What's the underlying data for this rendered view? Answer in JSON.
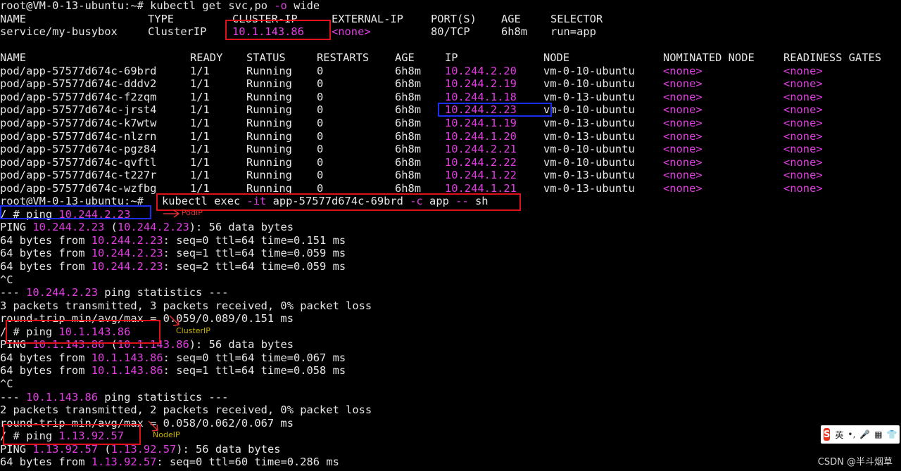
{
  "terminal": {
    "prompt_cmd_1": "root@VM-0-13-ubuntu:~# kubectl get svc,po -o wide",
    "svc_headers": [
      "NAME",
      "TYPE",
      "CLUSTER-IP",
      "EXTERNAL-IP",
      "PORT(S)",
      "AGE",
      "SELECTOR"
    ],
    "svc_row": [
      "service/my-busybox",
      "ClusterIP",
      "10.1.143.86",
      "<none>",
      "80/TCP",
      "6h8m",
      "run=app"
    ],
    "pod_headers": [
      "NAME",
      "READY",
      "STATUS",
      "RESTARTS",
      "AGE",
      "IP",
      "NODE",
      "NOMINATED NODE",
      "READINESS GATES"
    ],
    "pods": [
      [
        "pod/app-57577d674c-69brd",
        "1/1",
        "Running",
        "0",
        "6h8m",
        "10.244.2.20",
        "vm-0-10-ubuntu",
        "<none>",
        "<none>"
      ],
      [
        "pod/app-57577d674c-dddv2",
        "1/1",
        "Running",
        "0",
        "6h8m",
        "10.244.2.19",
        "vm-0-10-ubuntu",
        "<none>",
        "<none>"
      ],
      [
        "pod/app-57577d674c-f2zqm",
        "1/1",
        "Running",
        "0",
        "6h8m",
        "10.244.1.18",
        "vm-0-13-ubuntu",
        "<none>",
        "<none>"
      ],
      [
        "pod/app-57577d674c-jrst4",
        "1/1",
        "Running",
        "0",
        "6h8m",
        "10.244.2.23",
        "vm-0-10-ubuntu",
        "<none>",
        "<none>"
      ],
      [
        "pod/app-57577d674c-k7wtw",
        "1/1",
        "Running",
        "0",
        "6h8m",
        "10.244.1.19",
        "vm-0-13-ubuntu",
        "<none>",
        "<none>"
      ],
      [
        "pod/app-57577d674c-nlzrn",
        "1/1",
        "Running",
        "0",
        "6h8m",
        "10.244.1.20",
        "vm-0-13-ubuntu",
        "<none>",
        "<none>"
      ],
      [
        "pod/app-57577d674c-pgz84",
        "1/1",
        "Running",
        "0",
        "6h8m",
        "10.244.2.21",
        "vm-0-10-ubuntu",
        "<none>",
        "<none>"
      ],
      [
        "pod/app-57577d674c-qvftl",
        "1/1",
        "Running",
        "0",
        "6h8m",
        "10.244.2.22",
        "vm-0-10-ubuntu",
        "<none>",
        "<none>"
      ],
      [
        "pod/app-57577d674c-t227r",
        "1/1",
        "Running",
        "0",
        "6h8m",
        "10.244.1.22",
        "vm-0-13-ubuntu",
        "<none>",
        "<none>"
      ],
      [
        "pod/app-57577d674c-wzfbg",
        "1/1",
        "Running",
        "0",
        "6h8m",
        "10.244.1.21",
        "vm-0-13-ubuntu",
        "<none>",
        "<none>"
      ]
    ],
    "exec_prompt": "root@VM-0-13-ubuntu:~#",
    "exec_cmd": "kubectl exec -it app-57577d674c-69brd -c app -- sh",
    "ping1": {
      "prompt": "/ # ping ",
      "target": "10.244.2.23",
      "header": [
        "PING ",
        "10.244.2.23",
        " (",
        "10.244.2.23",
        "): 56 data bytes"
      ],
      "replies": [
        [
          "64 bytes from ",
          "10.244.2.23",
          ": seq=0 ttl=64 time=0.151 ms"
        ],
        [
          "64 bytes from ",
          "10.244.2.23",
          ": seq=1 ttl=64 time=0.059 ms"
        ],
        [
          "64 bytes from ",
          "10.244.2.23",
          ": seq=2 ttl=64 time=0.059 ms"
        ]
      ],
      "interrupt": "^C",
      "stats_title": [
        "--- ",
        "10.244.2.23",
        " ping statistics ---"
      ],
      "packets": "3 packets transmitted, 3 packets received, 0% packet loss",
      "rtt": "round-trip min/avg/max = 0.059/0.089/0.151 ms"
    },
    "ping2": {
      "prompt": "/ # ping ",
      "target": "10.1.143.86",
      "header": [
        "PING ",
        "10.1.143.86",
        " (",
        "10.1.143.86",
        "): 56 data bytes"
      ],
      "replies": [
        [
          "64 bytes from ",
          "10.1.143.86",
          ": seq=0 ttl=64 time=0.067 ms"
        ],
        [
          "64 bytes from ",
          "10.1.143.86",
          ": seq=1 ttl=64 time=0.058 ms"
        ]
      ],
      "interrupt": "^C",
      "stats_title": [
        "--- ",
        "10.1.143.86",
        " ping statistics ---"
      ],
      "packets": "2 packets transmitted, 2 packets received, 0% packet loss",
      "rtt": "round-trip min/avg/max = 0.058/0.062/0.067 ms"
    },
    "ping3": {
      "prompt": "/ # ping ",
      "target": "1.13.92.57",
      "header": [
        "PING ",
        "1.13.92.57",
        " (",
        "1.13.92.57",
        "): 56 data bytes"
      ],
      "replies": [
        [
          "64 bytes from ",
          "1.13.92.57",
          ": seq=0 ttl=60 time=0.286 ms"
        ]
      ]
    }
  },
  "annotations": {
    "pod_ip": "PodIP",
    "cluster_ip": "ClusterIP",
    "node_ip": "NodeIP"
  },
  "ime": {
    "logo": "S",
    "lang": "英",
    "punct": "•,",
    "mic": "🎤",
    "grid": "▦",
    "shirt": "👕",
    "apps": "⋮⋮"
  },
  "watermark": "CSDN @半斗烟草",
  "colors": {
    "highlight": "#e23ee2",
    "red_box": "#e0101a",
    "blue_box": "#1a2ef0",
    "ann_red": "#e03030",
    "ann_yellow": "#c8b400"
  }
}
